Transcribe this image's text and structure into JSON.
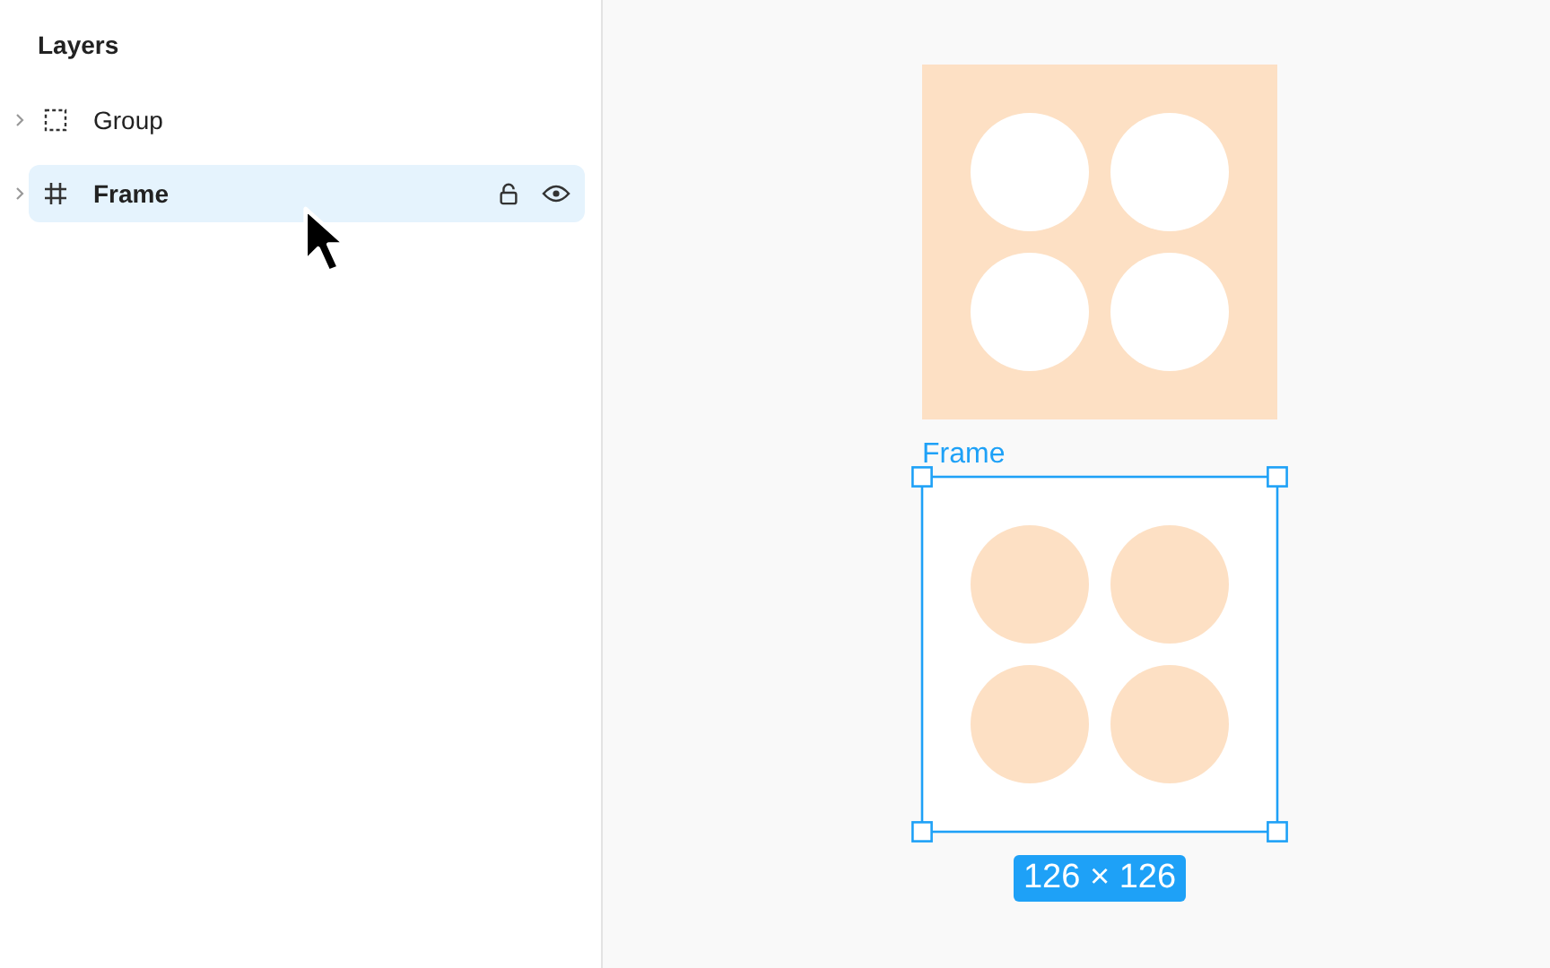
{
  "layers_panel": {
    "title": "Layers",
    "layers": [
      {
        "label": "Group",
        "kind": "group",
        "selected": false
      },
      {
        "label": "Frame",
        "kind": "frame",
        "selected": true
      }
    ]
  },
  "canvas": {
    "artboards": [
      {
        "kind": "filled",
        "selected": false
      },
      {
        "kind": "outlined",
        "selected": true,
        "label": "Frame",
        "size": "126 × 126"
      }
    ]
  }
}
